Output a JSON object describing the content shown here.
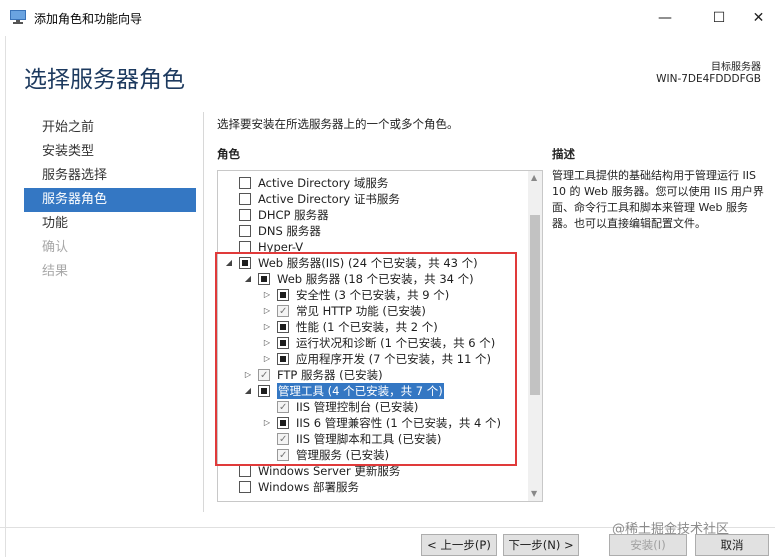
{
  "window": {
    "title": "添加角色和功能向导",
    "min_glyph": "—",
    "max_glyph": "☐",
    "close_glyph": "✕"
  },
  "header": {
    "page_title": "选择服务器角色",
    "target_label": "目标服务器",
    "target_name": "WIN-7DE4FDDDFGB"
  },
  "nav": {
    "items": [
      {
        "label": "开始之前",
        "state": "normal"
      },
      {
        "label": "安装类型",
        "state": "normal"
      },
      {
        "label": "服务器选择",
        "state": "normal"
      },
      {
        "label": "服务器角色",
        "state": "active"
      },
      {
        "label": "功能",
        "state": "normal"
      },
      {
        "label": "确认",
        "state": "disabled"
      },
      {
        "label": "结果",
        "state": "disabled"
      }
    ]
  },
  "main": {
    "instruction": "选择要安装在所选服务器上的一个或多个角色。",
    "roles_header": "角色",
    "description_header": "描述",
    "description_text": "管理工具提供的基础结构用于管理运行 IIS 10 的 Web 服务器。您可以使用 IIS 用户界面、命令行工具和脚本来管理 Web 服务器。也可以直接编辑配置文件。"
  },
  "tree": [
    {
      "label": "Active Directory 域服务",
      "level": 0,
      "expander": "",
      "check": "unchecked"
    },
    {
      "label": "Active Directory 证书服务",
      "level": 0,
      "expander": "",
      "check": "unchecked"
    },
    {
      "label": "DHCP 服务器",
      "level": 0,
      "expander": "",
      "check": "unchecked"
    },
    {
      "label": "DNS 服务器",
      "level": 0,
      "expander": "",
      "check": "unchecked"
    },
    {
      "label": "Hyper-V",
      "level": 0,
      "expander": "",
      "check": "unchecked"
    },
    {
      "label": "Web 服务器(IIS) (24 个已安装，共 43 个)",
      "level": 0,
      "expander": "open",
      "check": "partial"
    },
    {
      "label": "Web 服务器 (18 个已安装，共 34 个)",
      "level": 1,
      "expander": "open",
      "check": "partial"
    },
    {
      "label": "安全性 (3 个已安装，共 9 个)",
      "level": 2,
      "expander": "closed",
      "check": "partial"
    },
    {
      "label": "常见 HTTP 功能 (已安装)",
      "level": 2,
      "expander": "closed",
      "check": "checked"
    },
    {
      "label": "性能 (1 个已安装，共 2 个)",
      "level": 2,
      "expander": "closed",
      "check": "partial"
    },
    {
      "label": "运行状况和诊断 (1 个已安装，共 6 个)",
      "level": 2,
      "expander": "closed",
      "check": "partial"
    },
    {
      "label": "应用程序开发 (7 个已安装，共 11 个)",
      "level": 2,
      "expander": "closed",
      "check": "partial"
    },
    {
      "label": "FTP 服务器 (已安装)",
      "level": 1,
      "expander": "closed",
      "check": "checked"
    },
    {
      "label": "管理工具 (4 个已安装，共 7 个)",
      "level": 1,
      "expander": "open",
      "check": "partial",
      "selected": true
    },
    {
      "label": "IIS 管理控制台 (已安装)",
      "level": 2,
      "expander": "",
      "check": "checked"
    },
    {
      "label": "IIS 6 管理兼容性 (1 个已安装，共 4 个)",
      "level": 2,
      "expander": "closed",
      "check": "partial"
    },
    {
      "label": "IIS 管理脚本和工具 (已安装)",
      "level": 2,
      "expander": "",
      "check": "checked"
    },
    {
      "label": "管理服务 (已安装)",
      "level": 2,
      "expander": "",
      "check": "checked"
    },
    {
      "label": "Windows Server 更新服务",
      "level": 0,
      "expander": "",
      "check": "unchecked"
    },
    {
      "label": "Windows 部署服务",
      "level": 0,
      "expander": "",
      "check": "unchecked"
    }
  ],
  "buttons": {
    "prev": "< 上一步(P)",
    "next": "下一步(N) >",
    "install": "安装(I)",
    "cancel": "取消"
  },
  "watermark": "@稀土掘金技术社区",
  "colors": {
    "accent": "#3477c3",
    "title": "#1d3a5f",
    "highlight_box": "#e03a3a"
  }
}
